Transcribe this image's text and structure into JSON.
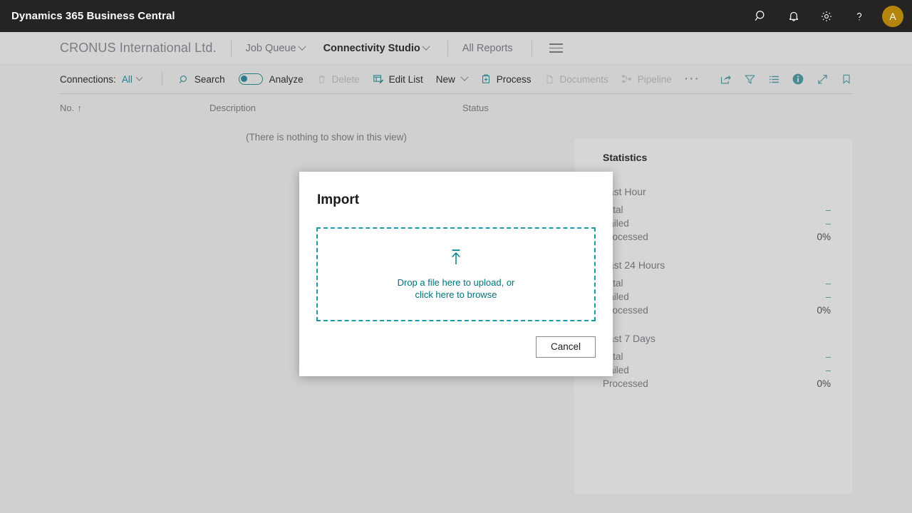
{
  "appbar": {
    "title": "Dynamics 365 Business Central",
    "icons": [
      {
        "name": "search-icon",
        "label": "Search"
      },
      {
        "name": "bell-icon",
        "label": "Notifications"
      },
      {
        "name": "gear-icon",
        "label": "Settings"
      },
      {
        "name": "help-icon",
        "label": "Help"
      }
    ],
    "avatar_initial": "A"
  },
  "navbar": {
    "company": "CRONUS International Ltd.",
    "items": [
      {
        "label": "Job Queue",
        "has_chevron": true,
        "active": false
      },
      {
        "label": "Connectivity Studio",
        "has_chevron": true,
        "active": true
      },
      {
        "label": "All Reports",
        "has_chevron": false,
        "active": false
      }
    ],
    "menu_icon": "hamburger-icon"
  },
  "toolbar": {
    "filter_label": "Connections:",
    "filter_value": "All",
    "search_label": "Search",
    "analyze_label": "Analyze",
    "analyze_toggle_on": true,
    "delete_label": "Delete",
    "edit_list_label": "Edit List",
    "new_label": "New",
    "process_label": "Process",
    "documents_label": "Documents",
    "pipeline_label": "Pipeline",
    "overflow_label": "···",
    "right_icons": [
      {
        "name": "share-icon"
      },
      {
        "name": "filter-icon"
      },
      {
        "name": "list-icon"
      },
      {
        "name": "info-icon"
      },
      {
        "name": "expand-icon"
      },
      {
        "name": "bookmark-icon"
      }
    ]
  },
  "list": {
    "columns": {
      "no": "No.",
      "sort_indicator": "↑",
      "description": "Description",
      "status": "Status"
    },
    "empty_message": "(There is nothing to show in this view)"
  },
  "factbox": {
    "title": "Statistics",
    "groups": [
      {
        "title": "Last Hour",
        "rows": [
          {
            "label": "Total",
            "value": "–"
          },
          {
            "label": "Failed",
            "value": "–"
          },
          {
            "label": "Processed",
            "value": "0%"
          }
        ]
      },
      {
        "title": "Last 24 Hours",
        "rows": [
          {
            "label": "Total",
            "value": "–"
          },
          {
            "label": "Failed",
            "value": "–"
          },
          {
            "label": "Processed",
            "value": "0%"
          }
        ]
      },
      {
        "title": "Last 7 Days",
        "rows": [
          {
            "label": "Total",
            "value": "–"
          },
          {
            "label": "Failed",
            "value": "–"
          },
          {
            "label": "Processed",
            "value": "0%"
          }
        ]
      }
    ]
  },
  "dialog": {
    "title": "Import",
    "dropzone_icon": "upload-icon",
    "dropzone_line1": "Drop a file here to upload, or",
    "dropzone_line2": "click here to browse",
    "cancel_label": "Cancel"
  },
  "colors": {
    "appbar_bg": "#252423",
    "page_bg": "#d0d0d0",
    "accent_teal": "#2c7d87",
    "dropzone_teal": "#1a9ba8",
    "avatar_gold": "#b3860b"
  }
}
